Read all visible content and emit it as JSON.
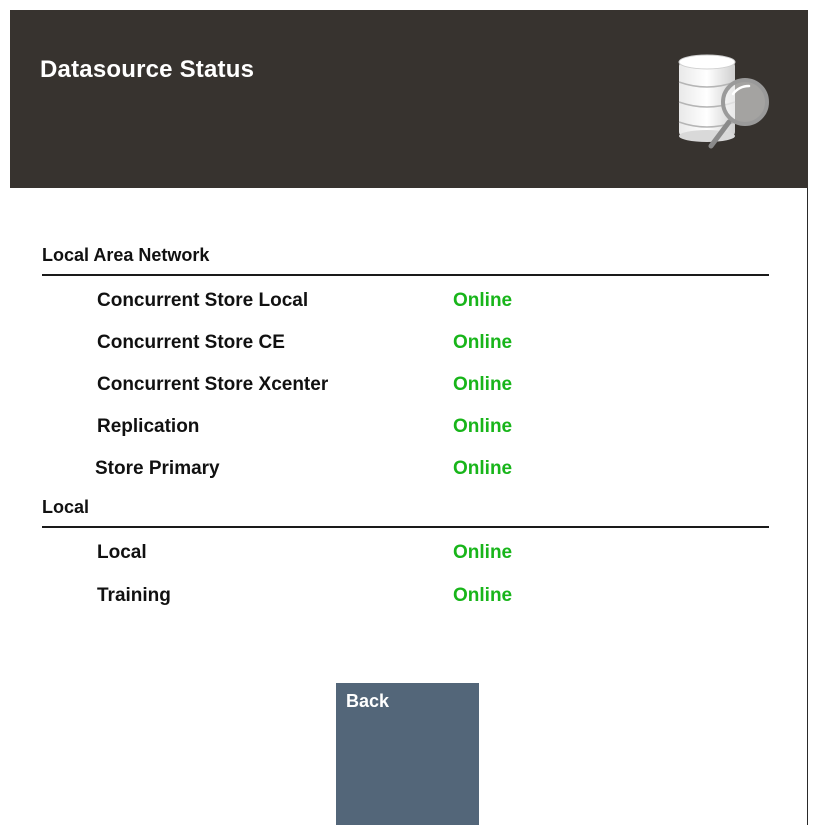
{
  "header": {
    "title": "Datasource Status",
    "icon": "database-search-icon"
  },
  "sections": [
    {
      "title": "Local Area Network",
      "rows": [
        {
          "name": "Concurrent Store Local",
          "status": "Online"
        },
        {
          "name": "Concurrent Store CE",
          "status": "Online"
        },
        {
          "name": "Concurrent Store Xcenter",
          "status": "Online"
        },
        {
          "name": "Replication",
          "status": "Online"
        },
        {
          "name": "Store Primary",
          "status": "Online"
        }
      ]
    },
    {
      "title": "Local",
      "rows": [
        {
          "name": "Local",
          "status": "Online"
        },
        {
          "name": "Training",
          "status": "Online"
        }
      ]
    }
  ],
  "actions": {
    "back_label": "Back"
  },
  "colors": {
    "header_bg": "#37332f",
    "status_online": "#18b51a",
    "button_bg": "#536679"
  }
}
